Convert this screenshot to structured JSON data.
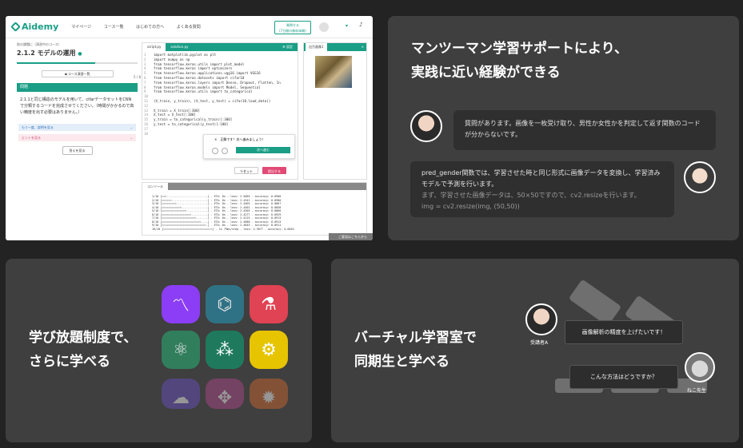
{
  "screenshot": {
    "logo": "Aidemy",
    "nav": [
      "マイページ",
      "コース一覧",
      "はじめての方へ",
      "よくある質問"
    ],
    "register": "質問する\n(7日間の無料体験)",
    "breadcrumb": "前の課題に（演習中のコース）",
    "course_title": "2.1.2 モデルの運用",
    "progress_label": "5 / 8",
    "progress": 0.65,
    "page_nav": "◀ コース演習一覧",
    "tab": "問題",
    "description": "2.1.1と同じ構造のモデルを用いて、cifarデータセットをCNNで分類するコードを完成させてください。（時間がかかるので高い精度を出す必要はありません。）",
    "accordion_hint": "もう一度、説明を見る",
    "accordion_pink": "ヒントを見る",
    "answer_button": "答えを見る",
    "editor_tabs": [
      "script.py",
      "solution.py"
    ],
    "editor_settings": "⚙ 設定",
    "code": [
      "import matplotlib.pyplot as plt",
      "import numpy as np",
      "from tensorflow.keras.utils import plot_model",
      "from tensorflow.keras import optimizers",
      "from tensorflow.keras.applications.vgg16 import VGG16",
      "from tensorflow.keras.datasets import cifar10",
      "from tensorflow.keras.layers import Dense, Dropout, Flatten, In",
      "from tensorflow.keras.models import Model, Sequential",
      "from tensorflow.keras.utils import to_categorical",
      "",
      "(X_train, y_train), (X_test, y_test) = cifar10.load_data()",
      "",
      "X_train = X_train[:300]",
      "X_test = X_test[:100]",
      "y_train = to_categorical(y_train)[:300]",
      "y_test = to_categorical(y_test)[:100]",
      "",
      ""
    ],
    "popup_text": "正解です！次へ進みましょう！",
    "popup_next": "次へ進む",
    "reset_button": "リセット",
    "submit_button": "提出する",
    "output_tab": "出力画像1",
    "console_tab": "コンソール",
    "console_lines": [
      "1/10 [==>.........................] - ETA: 0s - loss: 2.5005 - accuracy: 0.0900",
      "2/10 [=====>......................] - ETA: 0s - loss: 2.4341 - accuracy: 0.0900",
      "3/10 [========>...................] - ETA: 0s - loss: 2.4405 - accuracy: 0.0867",
      "4/10 [===========>................] - ETA: 0s - loss: 2.4402 - accuracy: 0.0850",
      "5/10 [==============>.............] - ETA: 0s - loss: 2.4305 - accuracy: 0.0860",
      "6/10 [=================>..........] - ETA: 0s - loss: 2.4277 - accuracy: 0.0929",
      "7/10 [====================>.......] - ETA: 0s - loss: 2.4115 - accuracy: 0.0913",
      "8/10 [=======================>....] - ETA: 0s - loss: 2.4088 - accuracy: 0.0913",
      "9/10 [==========================>.] - ETA: 0s - loss: 2.4045 - accuracy: 0.0911",
      "10/10 [==============================] - 1s 79ms/step - loss: 2.3077 - accuracy: 0.0810"
    ],
    "help_button": "ご意見はこちらから"
  },
  "mentor": {
    "heading_line1": "マンツーマン学習サポートにより、",
    "heading_line2": "実践に近い経験ができる",
    "question": "質問があります。画像を一枚受け取り、男性か女性かを判定して返す関数のコードが分からないです。",
    "answer_line1": "pred_gender関数では、学習させた時と同じ形式に画像データを変換し、学習済みモデルで予測を行います。",
    "answer_line2": "まず、学習させた画像データは、50×50ですので、cv2.resizeを行います。",
    "answer_code": "img = cv2.resize(img, (50,50))"
  },
  "unlimited": {
    "heading_line1": "学び放題制度で、",
    "heading_line2": "さらに学べる",
    "apps": [
      {
        "icon": "trend-chart-icon",
        "glyph": "〽",
        "color": "#8b3ef5"
      },
      {
        "icon": "molecule-icon",
        "glyph": "⌬",
        "color": "#2e7c92"
      },
      {
        "icon": "flask-icon",
        "glyph": "⚗",
        "color": "#e04353"
      },
      {
        "icon": "atom-icon",
        "glyph": "⚛",
        "color": "#2f8a63"
      },
      {
        "icon": "network-icon",
        "glyph": "⁂",
        "color": "#1f7a5d"
      },
      {
        "icon": "gear-icon",
        "glyph": "⚙",
        "color": "#e6c400"
      },
      {
        "icon": "brain-icon",
        "glyph": "☁",
        "color": "#6a4fc9"
      },
      {
        "icon": "connector-icon",
        "glyph": "✥",
        "color": "#b5468d"
      },
      {
        "icon": "sun-icon",
        "glyph": "✹",
        "color": "#d76a2d"
      }
    ]
  },
  "virtual_room": {
    "heading_line1": "バーチャル学習室で",
    "heading_line2": "同期生と学べる",
    "student_label": "受講者A",
    "student_message": "画像解析の精度を上げたいです！",
    "teacher_label": "ねこ先生",
    "teacher_message": "こんな方法はどうですか？"
  }
}
